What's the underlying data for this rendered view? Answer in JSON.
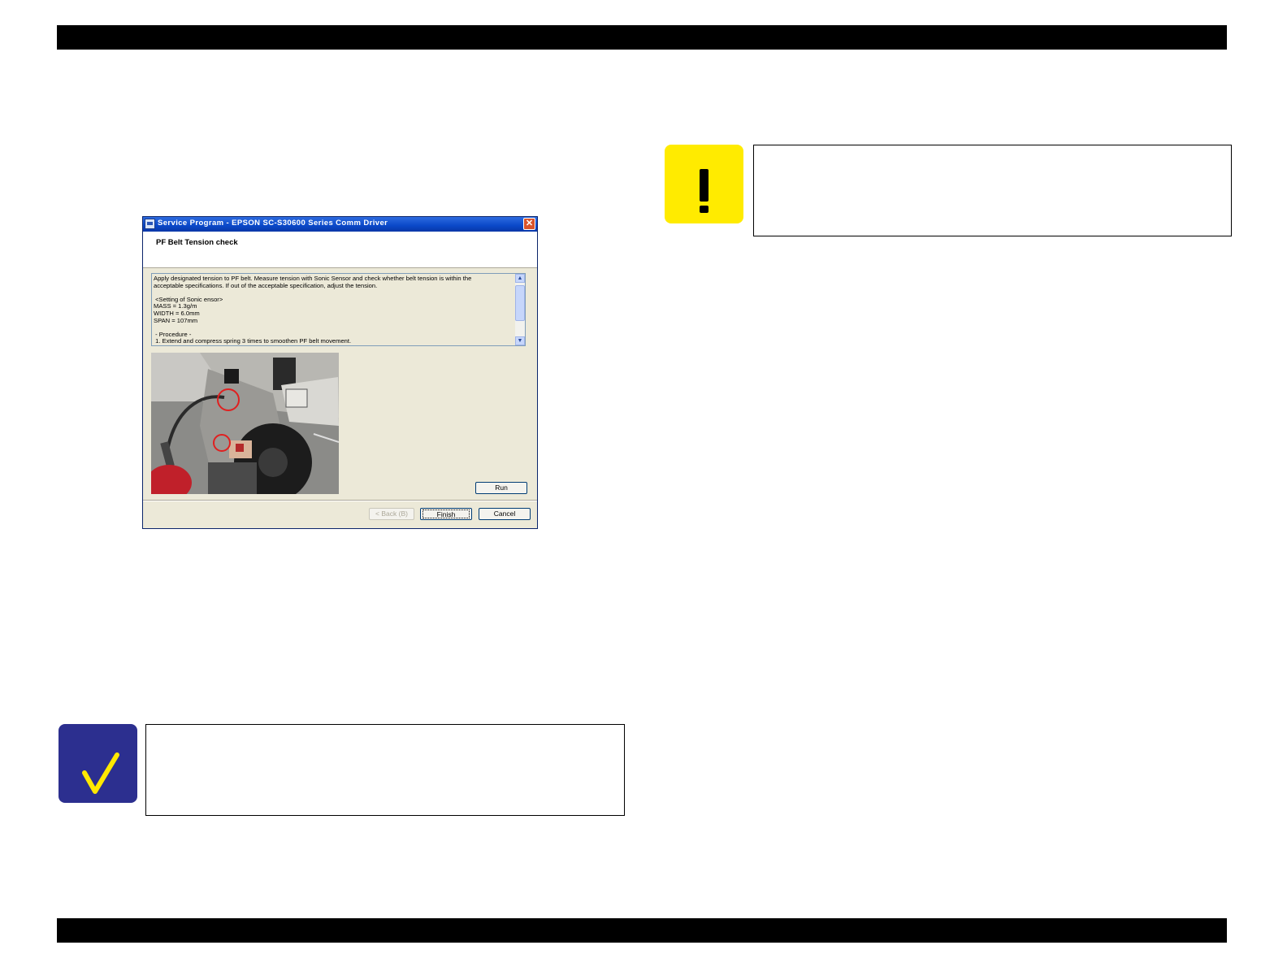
{
  "dialog": {
    "title": "Service Program - EPSON SC-S30600 Series Comm Driver",
    "close_glyph": "✕",
    "heading": "PF Belt Tension check",
    "description_lines": [
      "Apply designated tension to PF belt. Measure tension with Sonic Sensor and check whether belt tension is within the",
      "acceptable specifications. If out of the acceptable specification, adjust the tension.",
      "",
      " <Setting of Sonic ensor>",
      "MASS = 1.3g/m",
      "WIDTH = 6.0mm",
      "SPAN = 107mm",
      "",
      " - Procedure -",
      " 1. Extend and compress spring 3 times to smoothen PF belt movement."
    ],
    "scroll_up_glyph": "▲",
    "scroll_down_glyph": "▼",
    "run_label": "Run",
    "back_label": "< Back (B)",
    "finish_label": "Finish",
    "cancel_label": "Cancel"
  },
  "caution_icon": {
    "glyph": "!",
    "color": "#ffeb00",
    "name": "exclamation-icon"
  },
  "check_icon": {
    "glyph": "✓",
    "color": "#2c2f8f",
    "check_color": "#ffe800",
    "name": "checkmark-icon"
  }
}
